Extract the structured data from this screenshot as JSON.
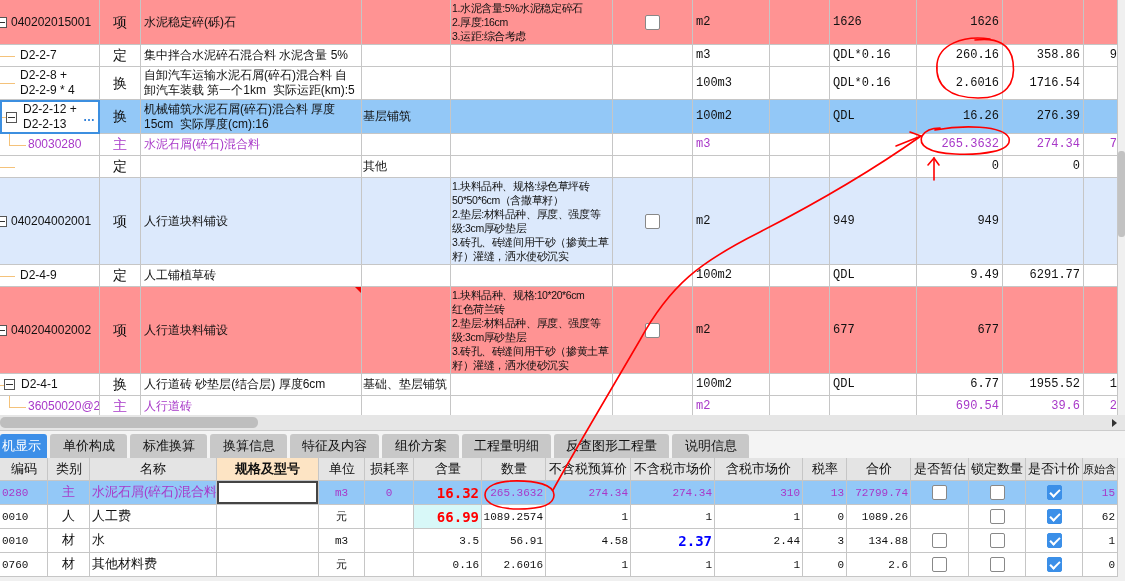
{
  "top_grid": {
    "rows": [
      {
        "code": "040202015001",
        "kind": "item",
        "flagged": true,
        "expanded": true,
        "selected": false,
        "checked": false,
        "cells": [
          "项",
          "水泥稳定碎(砾)石",
          null,
          "1.水泥含量:5%水泥稳定碎石\n2.厚度:16cm\n3.运距:综合考虑",
          "m2",
          null,
          "1626",
          "1626",
          null,
          null
        ],
        "children": [
          {
            "code": "D2-2-7",
            "kind": "quota",
            "selected": false,
            "cells": [
              "定",
              "集中拌合水泥碎石混合料 水泥含量 5%",
              null,
              null,
              "m3",
              null,
              "QDL*0.16",
              "260.16",
              "358.86",
              "9"
            ]
          },
          {
            "code": "D2-2-8 +\nD2-2-9 * 4",
            "kind": "quota",
            "selected": false,
            "cells": [
              "换",
              "自卸汽车运输水泥石屑(碎石)混合料 自卸汽车装载 第一个1km  实际运距(km):5",
              null,
              null,
              "100m3",
              null,
              "QDL*0.16",
              "2.6016",
              "1716.54",
              null
            ]
          },
          {
            "code": "D2-2-12 +\nD2-2-13",
            "kind": "quota",
            "expanded": true,
            "selected": true,
            "more_button": "…",
            "cells": [
              "换",
              "机械铺筑水泥石屑(碎石)混合料 厚度15cm  实际厚度(cm):16",
              "基层铺筑",
              null,
              "100m2",
              null,
              "QDL",
              "16.26",
              "276.39",
              null
            ],
            "children": [
              {
                "code": "80030280",
                "kind": "main",
                "selected": false,
                "cells": [
                  "主",
                  "水泥石屑(碎石)混合料",
                  null,
                  null,
                  "m3",
                  null,
                  null,
                  "265.3632",
                  "274.34",
                  "7"
                ]
              }
            ]
          },
          {
            "kind": "quota",
            "selected": false,
            "cells": [
              "定",
              null,
              "其他",
              null,
              null,
              null,
              null,
              "0",
              "0",
              null
            ]
          }
        ]
      },
      {
        "code": "040204002001",
        "kind": "item",
        "flagged": false,
        "expanded": true,
        "selected": false,
        "checked": false,
        "cells": [
          "项",
          "人行道块料铺设",
          null,
          "1.块料品种、规格:绿色草坪砖50*50*6cm（含撒草籽）\n2.垫层:材料品种、厚度、强度等级:3cm厚砂垫层\n3.砖孔、砖缝间用干砂（掺黄土草籽）灌缝，洒水使砂沉实",
          "m2",
          null,
          "949",
          "949",
          null,
          null
        ],
        "children": [
          {
            "code": "D2-4-9",
            "kind": "quota",
            "selected": false,
            "cells": [
              "定",
              "人工铺植草砖",
              null,
              null,
              "100m2",
              null,
              "QDL",
              "9.49",
              "6291.77",
              null
            ]
          }
        ]
      },
      {
        "code": "040204002002",
        "kind": "item",
        "flagged": true,
        "expanded": true,
        "selected": false,
        "checked": false,
        "cells": [
          "项",
          {
            "text": "人行道块料铺设",
            "note": true
          },
          null,
          "1.块料品种、规格:10*20*6cm\n红色荷兰砖\n2.垫层:材料品种、厚度、强度等级:3cm厚砂垫层\n3.砖孔、砖缝间用干砂（掺黄土草籽）灌缝，洒水使砂沉实",
          "m2",
          null,
          "677",
          "677",
          null,
          null
        ],
        "children": [
          {
            "code": "D2-4-1",
            "kind": "quota",
            "expanded": true,
            "selected": false,
            "cells": [
              "换",
              "人行道砖 砂垫层(结合层) 厚度6cm",
              "基础、垫层铺筑",
              null,
              "100m2",
              null,
              "QDL",
              "6.77",
              "1955.52",
              "1"
            ],
            "children": [
              {
                "code": "36050020@2",
                "kind": "main",
                "selected": false,
                "cells": [
                  "主",
                  "人行道砖",
                  null,
                  null,
                  "m2",
                  null,
                  null,
                  "690.54",
                  "39.6",
                  "2"
                ]
              }
            ]
          }
        ]
      }
    ]
  },
  "tabs": [
    {
      "label": "机显示",
      "selected": true
    },
    {
      "label": "单价构成",
      "selected": false
    },
    {
      "label": "标准换算",
      "selected": false
    },
    {
      "label": "换算信息",
      "selected": false
    },
    {
      "label": "特征及内容",
      "selected": false
    },
    {
      "label": "组价方案",
      "selected": false
    },
    {
      "label": "工程量明细",
      "selected": false
    },
    {
      "label": "反查图形工程量",
      "selected": false
    },
    {
      "label": "说明信息",
      "selected": false
    }
  ],
  "bottom_grid": {
    "columns": [
      {
        "label": "编码",
        "selected": false
      },
      {
        "label": "类别",
        "selected": false
      },
      {
        "label": "名称",
        "selected": false
      },
      {
        "label": "规格及型号",
        "selected": true
      },
      {
        "label": "单位",
        "selected": false
      },
      {
        "label": "损耗率",
        "selected": false
      },
      {
        "label": "含量",
        "selected": false
      },
      {
        "label": "数量",
        "selected": false
      },
      {
        "label": "不含税预算价",
        "selected": false
      },
      {
        "label": "不含税市场价",
        "selected": false
      },
      {
        "label": "含税市场价",
        "selected": false
      },
      {
        "label": "税率",
        "selected": false
      },
      {
        "label": "合价",
        "selected": false
      },
      {
        "label": "是否暂估",
        "selected": false
      },
      {
        "label": "锁定数量",
        "selected": false
      },
      {
        "label": "是否计价",
        "selected": false
      },
      {
        "label": "原始含",
        "selected": false
      }
    ],
    "rows": [
      {
        "kind": "main",
        "selected": true,
        "cells": [
          "0280",
          "主",
          "水泥石屑(碎石)混合料",
          {
            "editing": true
          },
          "m3",
          "0",
          {
            "text": "16.32",
            "color": "#ff0000"
          },
          "265.3632",
          "274.34",
          "274.34",
          "310",
          "13",
          "72799.74",
          {
            "checked": false
          },
          {
            "checked": false
          },
          {
            "checked": true
          },
          "15"
        ]
      },
      {
        "kind": "resource",
        "selected": false,
        "cells": [
          "0010",
          "人",
          "人工费",
          null,
          "元",
          null,
          {
            "text": "66.99",
            "color": "#ff0000",
            "highlight": true
          },
          "1089.2574",
          "1",
          "1",
          "1",
          "0",
          "1089.26",
          null,
          {
            "checked": false
          },
          {
            "checked": true
          },
          "62"
        ]
      },
      {
        "kind": "resource",
        "selected": false,
        "cells": [
          "0010",
          "材",
          "水",
          null,
          "m3",
          null,
          "3.5",
          "56.91",
          "4.58",
          {
            "text": "2.37",
            "color": "#0000ff"
          },
          "2.44",
          "3",
          "134.88",
          {
            "checked": false
          },
          {
            "checked": false
          },
          {
            "checked": true
          },
          "1"
        ]
      },
      {
        "kind": "resource",
        "selected": false,
        "cells": [
          "0760",
          "材",
          "其他材料费",
          null,
          "元",
          null,
          "0.16",
          "2.6016",
          "1",
          "1",
          "1",
          "0",
          "2.6",
          {
            "checked": false
          },
          {
            "checked": false
          },
          {
            "checked": true
          },
          "0"
        ]
      }
    ]
  }
}
